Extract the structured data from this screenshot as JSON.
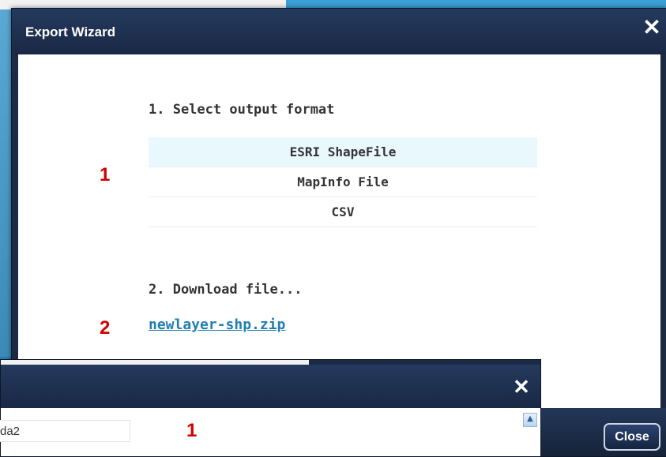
{
  "dialog": {
    "title": "Export Wizard",
    "close_x": "✕",
    "step1_title": "1. Select output format",
    "formats": [
      {
        "label": "ESRI ShapeFile",
        "selected": true
      },
      {
        "label": "MapInfo File",
        "selected": false
      },
      {
        "label": "CSV",
        "selected": false
      }
    ],
    "marker1": "1",
    "step2_title": "2. Download file...",
    "marker2": "2",
    "download_link": "newlayer-shp.zip",
    "close_button": "Close"
  },
  "dialog2": {
    "close_x": "✕",
    "name_value": "da2",
    "marker": "1",
    "scroll_up": "▲"
  },
  "colors": {
    "accent_red": "#d10000",
    "link_blue": "#1f7fb3",
    "titlebar": "#1c2a44",
    "selected_row": "#e9f8fd"
  }
}
